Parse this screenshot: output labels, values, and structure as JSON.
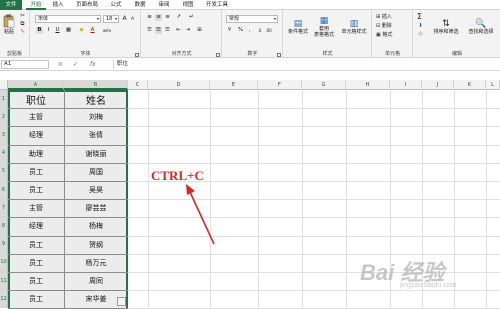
{
  "menu": {
    "tabs": [
      "文件",
      "开始",
      "插入",
      "页面布局",
      "公式",
      "数据",
      "审阅",
      "视图",
      "开发工具"
    ],
    "active": "开始"
  },
  "ribbon": {
    "clipboard": {
      "label": "剪贴板",
      "paste": "粘贴"
    },
    "font": {
      "label": "字体",
      "family": "宋体",
      "size": "18",
      "bold": "B",
      "italic": "I",
      "underline": "U",
      "grow": "A",
      "shrink": "A",
      "font_color": "A",
      "wen": "wén"
    },
    "alignment": {
      "label": "对齐方式"
    },
    "number": {
      "label": "数字",
      "format": "常规",
      "percent": "%",
      "comma": ","
    },
    "styles": {
      "label": "样式",
      "conditional": "条件格式",
      "table": "套用\n表格格式",
      "cell_styles": "单元格样式"
    },
    "cells": {
      "label": "单元格",
      "insert": "插入",
      "delete": "删除",
      "format": "格式"
    },
    "editing": {
      "label": "编辑",
      "sum": "Σ",
      "sort": "排序和筛选",
      "find": "查找和选择"
    }
  },
  "formula_bar": {
    "name_box": "A1",
    "fx": "fx",
    "cancel": "×",
    "enter": "✓",
    "value": "职位"
  },
  "columns": [
    "A",
    "B",
    "C",
    "D",
    "E",
    "F",
    "G",
    "H",
    "I",
    "J",
    "K",
    "L"
  ],
  "rows": [
    "1",
    "2",
    "3",
    "4",
    "5",
    "6",
    "7",
    "8",
    "9",
    "10",
    "11",
    "12"
  ],
  "table": {
    "headers": [
      "职位",
      "姓名"
    ],
    "rows": [
      [
        "主管",
        "刘梅"
      ],
      [
        "经理",
        "张倩"
      ],
      [
        "助理",
        "谢晓丽"
      ],
      [
        "员工",
        "周国"
      ],
      [
        "员工",
        "吴昊"
      ],
      [
        "主管",
        "廖芸芸"
      ],
      [
        "经理",
        "杨梅"
      ],
      [
        "员工",
        "贺纲"
      ],
      [
        "员工",
        "杨万元"
      ],
      [
        "员工",
        "周同"
      ],
      [
        "员工",
        "宋华姜"
      ]
    ]
  },
  "annotation": {
    "text": "CTRL+C",
    "color": "#e02424"
  },
  "watermark": {
    "main": "Bai 经验",
    "sub": "jingyan.baidu.com"
  },
  "colors": {
    "accent": "#217346"
  }
}
